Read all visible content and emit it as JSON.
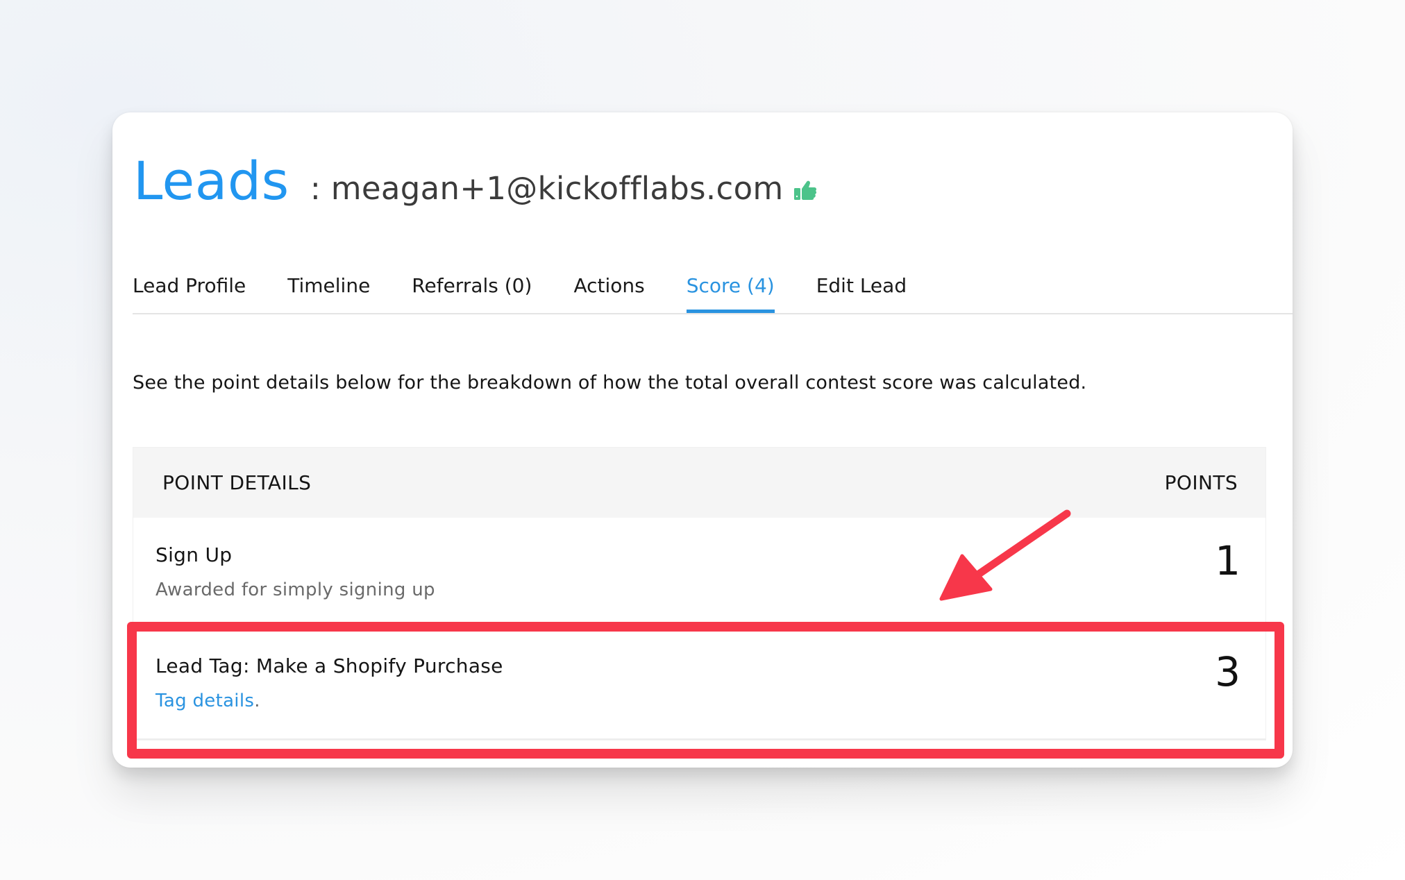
{
  "header": {
    "section_title": "Leads",
    "separator": ":",
    "lead_email": "meagan+1@kickofflabs.com",
    "status_icon": "thumbs-up-icon",
    "status_color": "#4cc38a"
  },
  "tabs": [
    {
      "label": "Lead Profile",
      "active": false
    },
    {
      "label": "Timeline",
      "active": false
    },
    {
      "label": "Referrals (0)",
      "active": false
    },
    {
      "label": "Actions",
      "active": false
    },
    {
      "label": "Score (4)",
      "active": true
    },
    {
      "label": "Edit Lead",
      "active": false
    }
  ],
  "description": "See the point details below for the breakdown of how the total overall contest score was calculated.",
  "points_table": {
    "columns": [
      "POINT DETAILS",
      "POINTS"
    ],
    "rows": [
      {
        "title": "Sign Up",
        "subtitle": "Awarded for simply signing up",
        "points": "1"
      },
      {
        "title": "Lead Tag: Make a Shopify Purchase",
        "link_text": "Tag details",
        "link_suffix": ".",
        "points": "3"
      }
    ]
  },
  "annotation": {
    "highlight_color": "#f7374a",
    "highlighted_row": "Lead Tag: Make a Shopify Purchase"
  },
  "colors": {
    "accent": "#2196f0",
    "link": "#2a93e0",
    "header_bg": "#f5f5f5"
  }
}
